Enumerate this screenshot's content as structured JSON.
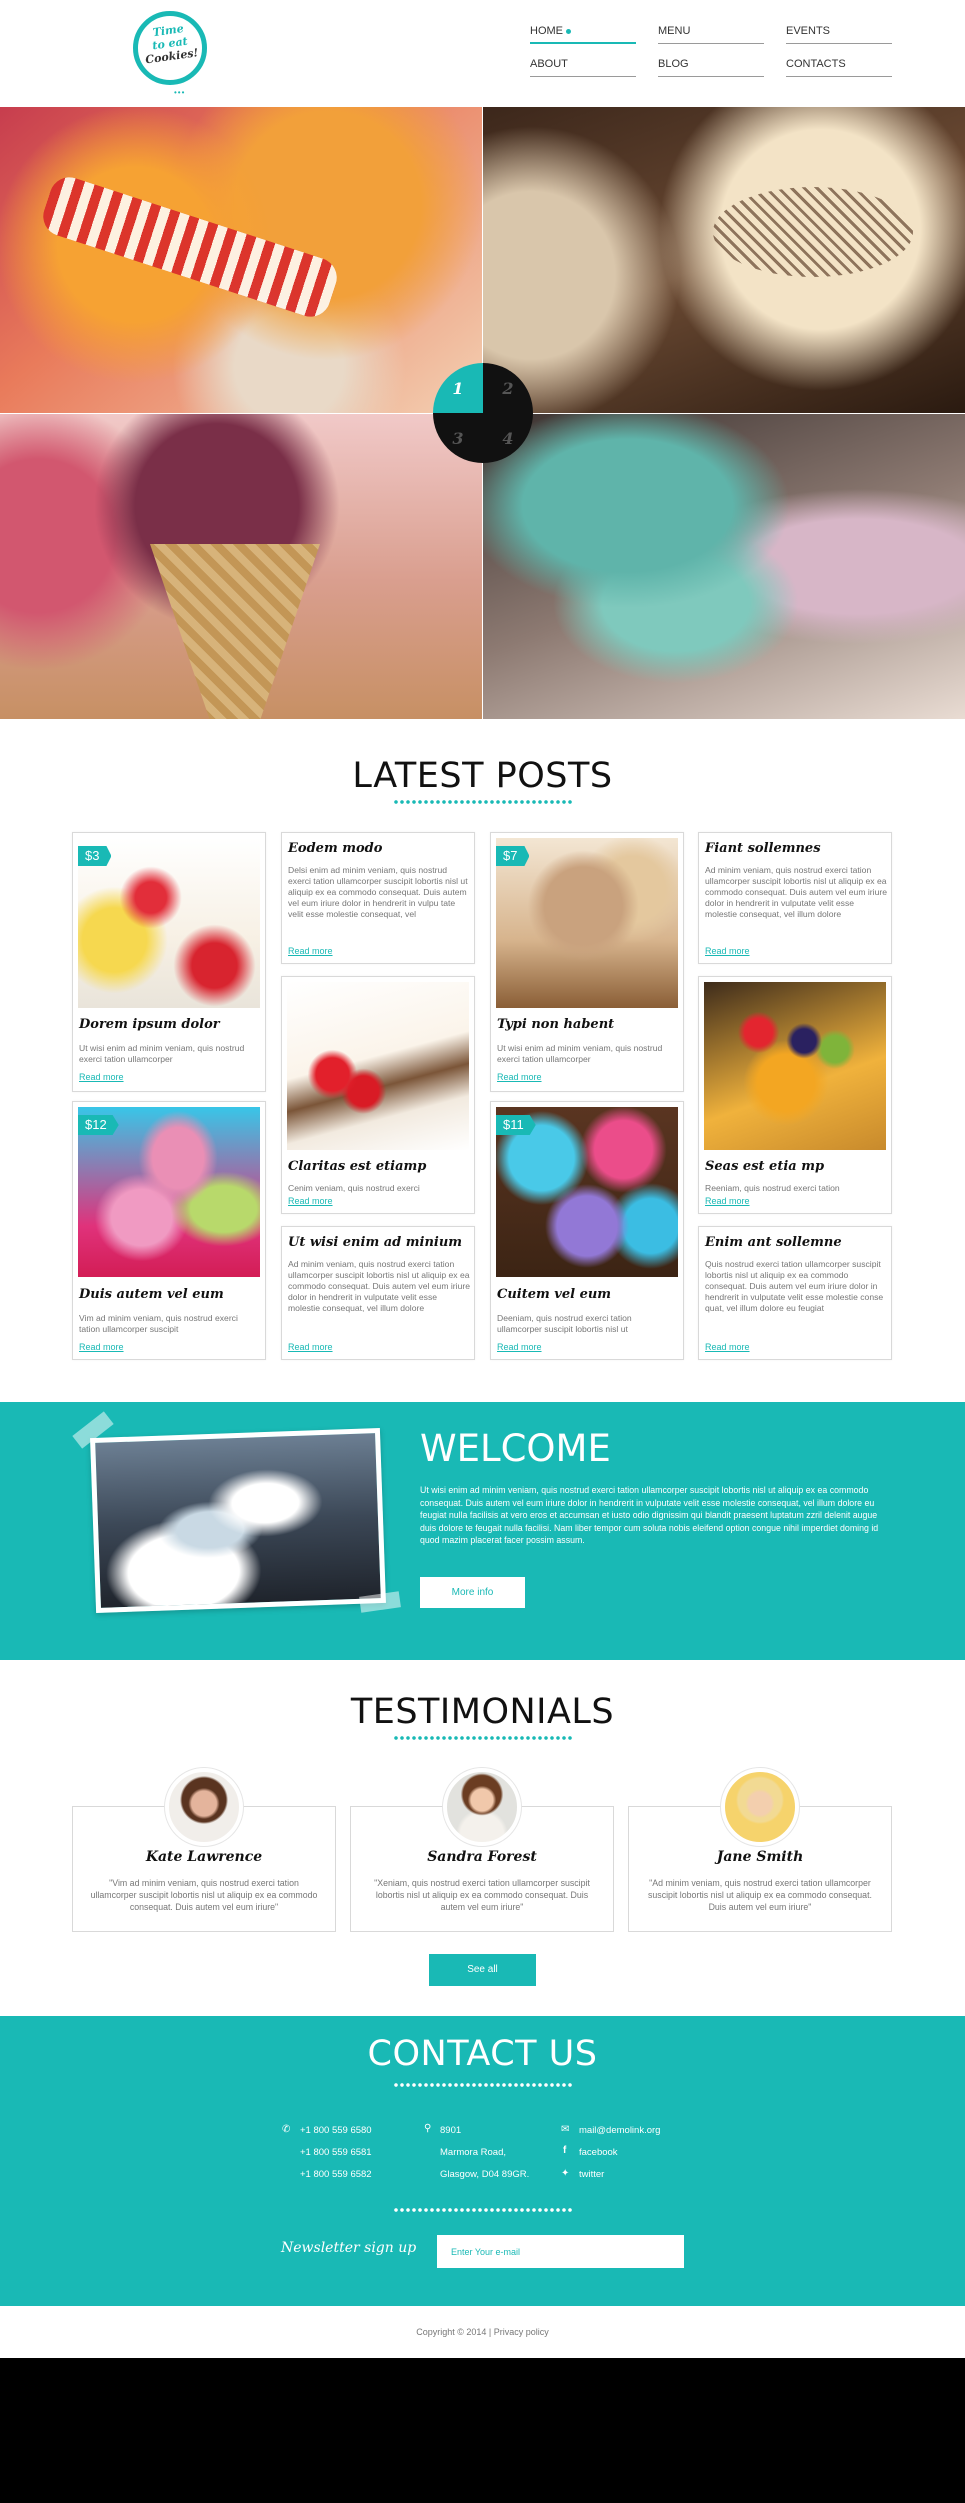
{
  "logo": {
    "line1": "Time",
    "line2": "to eat",
    "line3": "Cookies!"
  },
  "nav": {
    "items": [
      {
        "label": "HOME"
      },
      {
        "label": "MENU"
      },
      {
        "label": "EVENTS"
      },
      {
        "label": "ABOUT"
      },
      {
        "label": "BLOG"
      },
      {
        "label": "CONTACTS"
      }
    ],
    "active": "HOME"
  },
  "slider": {
    "buttons": [
      "1",
      "2",
      "3",
      "4"
    ],
    "active": "1"
  },
  "latest_posts": {
    "title": "LATEST POSTS",
    "read_more": "Read more",
    "posts": [
      {
        "price": "$3",
        "title": "Dorem ipsum dolor",
        "text": "Ut wisi enim ad minim veniam, quis nostrud exerci tation ullamcorper"
      },
      {
        "price": "$12",
        "title": "Duis autem vel eum",
        "text": "Vim ad minim veniam, quis nostrud exerci tation ullamcorper suscipit"
      },
      {
        "title": "Eodem modo",
        "text": "Delsi enim ad minim veniam, quis nostrud exerci tation ullamcorper suscipit lobortis nisl ut aliquip ex ea commodo consequat. Duis autem vel eum iriure dolor in hendrerit in vulpu tate velit esse molestie consequat, vel"
      },
      {
        "title": "Claritas est etiamp",
        "text": "Cenim veniam, quis nostrud exerci"
      },
      {
        "title": "Ut wisi enim ad minium",
        "text": "Ad minim veniam, quis nostrud exerci tation ullamcorper suscipit lobortis nisl ut aliquip ex ea commodo consequat. Duis autem vel eum iriure dolor in hendrerit in vulputate velit esse molestie consequat, vel illum dolore"
      },
      {
        "price": "$7",
        "title": "Typi non habent",
        "text": "Ut wisi enim ad minim veniam, quis nostrud exerci tation ullamcorper"
      },
      {
        "price": "$11",
        "title": "Cuitem vel eum",
        "text": "Deeniam, quis nostrud exerci tation ullamcorper suscipit lobortis nisl ut"
      },
      {
        "title": "Fiant sollemnes",
        "text": "Ad minim veniam, quis nostrud exerci tation ullamcorper suscipit lobortis nisl ut aliquip ex ea commodo consequat. Duis autem vel eum iriure dolor in hendrerit in vulputate velit esse molestie consequat, vel illum dolore"
      },
      {
        "title": "Seas est etia mp",
        "text": "Reeniam, quis nostrud exerci tation"
      },
      {
        "title": "Enim ant sollemne",
        "text": "Quis nostrud exerci tation ullamcorper suscipit lobortis nisl ut aliquip ex ea commodo consequat. Duis autem vel eum iriure dolor in hendrerit in vulputate velit esse molestie conse quat, vel illum dolore eu feugiat"
      }
    ]
  },
  "welcome": {
    "title": "WELCOME",
    "text": "Ut wisi enim ad minim veniam, quis nostrud exerci tation ullamcorper suscipit lobortis nisl ut aliquip ex ea commodo consequat. Duis autem vel eum iriure dolor in hendrerit in vulputate velit esse molestie consequat, vel illum dolore eu feugiat nulla facilisis at vero eros et accumsan et iusto odio dignissim qui blandit praesent luptatum zzril delenit augue duis dolore te feugait nulla facilisi. Nam liber tempor cum soluta nobis eleifend option congue nihil imperdiet doming id quod mazim placerat facer possim assum.",
    "button": "More info"
  },
  "testimonials": {
    "title": "TESTIMONIALS",
    "items": [
      {
        "name": "Kate Lawrence",
        "quote": "\"Vim ad minim veniam, quis nostrud exerci tation ullamcorper suscipit lobortis nisl ut aliquip ex ea commodo consequat. Duis autem vel eum iriure\""
      },
      {
        "name": "Sandra Forest",
        "quote": "\"Xeniam, quis nostrud exerci tation ullamcorper suscipit lobortis nisl ut aliquip ex ea commodo consequat. Duis autem vel eum iriure\""
      },
      {
        "name": "Jane Smith",
        "quote": "\"Ad minim veniam, quis nostrud exerci tation ullamcorper suscipit lobortis nisl ut aliquip ex ea commodo consequat. Duis autem vel eum iriure\""
      }
    ],
    "button": "See all"
  },
  "contact": {
    "title": "CONTACT US",
    "phones": [
      "+1 800 559 6580",
      "+1 800 559 6581",
      "+1 800 559 6582"
    ],
    "address": [
      "8901",
      "Marmora Road,",
      "Glasgow, D04 89GR."
    ],
    "email": "mail@demolink.org",
    "facebook": "facebook",
    "twitter": "twitter",
    "newsletter_label": "Newsletter sign up",
    "newsletter_placeholder": "Enter Your e-mail"
  },
  "footer": {
    "copyright": "Copyright © 2014 | Privacy policy"
  },
  "colors": {
    "accent": "#19b9b5",
    "text": "#555555",
    "bottom": "#000000"
  }
}
